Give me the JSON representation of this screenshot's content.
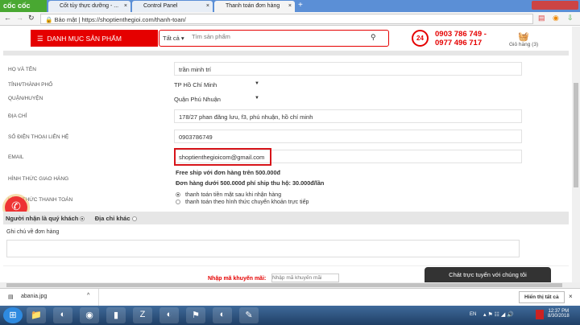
{
  "browser": {
    "brand": "cốc cốc",
    "tabs": [
      {
        "label": "Cốt tủy thực dưỡng - ..."
      },
      {
        "label": "Control Panel"
      },
      {
        "label": "Thanh toán đơn hàng"
      }
    ],
    "security": "Bảo mật",
    "url": "https://shoptienthegioi.com/thanh-toan/"
  },
  "header": {
    "category_label": "DANH MỤC SẢN PHẨM",
    "search_scope": "Tất cả",
    "search_placeholder": "Tìm sản phẩm",
    "phone1": "0903 786 749 -",
    "phone2": "0977 496 717",
    "cart_label": "Giỏ hàng (3)",
    "hotline_badge": "24"
  },
  "form": {
    "name_label": "HỌ VÀ TÊN",
    "name_value": "trần minh trí",
    "city_label": "TỈNH/THÀNH PHỐ",
    "city_value": "TP Hồ Chí Minh",
    "district_label": "QUẬN/HUYỆN",
    "district_value": "Quận Phú Nhuận",
    "address_label": "ĐỊA CHỈ",
    "address_value": "178/27 phan đăng lưu, f3, phú nhuận, hồ chí minh",
    "phone_label": "SỐ ĐIỆN THOẠI LIÊN HỆ",
    "phone_value": "0903786749",
    "email_label": "EMAIL",
    "email_value": "shoptienthegioicom@gmail.com",
    "shipping_label": "HÌNH THỨC GIAO HÀNG",
    "shipping_line1": "Free ship với đơn hàng trên 500.000đ",
    "shipping_line2": "Đơn hàng dưới 500.000đ phí ship thu hộ: 30.000đ/lần",
    "payment_label": "HÌNH THỨC THANH TOÁN",
    "payment_options": [
      {
        "label": "thanh toán tiền mặt sau khi nhận hàng",
        "selected": true
      },
      {
        "label": "thanh toán theo hình thức chuyển khoản trực tiếp",
        "selected": false
      }
    ],
    "recipient_self": "Người nhận là quý khách",
    "recipient_other": "Địa chỉ khác",
    "note_label": "Ghi chú về đơn hàng",
    "promo_label": "Nhập mã khuyến mãi:",
    "promo_placeholder": "Nhập mã khuyến mãi"
  },
  "chat_label": "Chát trực tuyến với chúng tôi",
  "download": {
    "file": "abania.jpg",
    "show_all": "Hiển thị tất cả"
  },
  "taskbar": {
    "lang": "EN",
    "time": "12:37 PM",
    "date": "8/30/2018"
  },
  "colors": {
    "accent": "#e50000",
    "highlight_box": "#d7141a"
  }
}
